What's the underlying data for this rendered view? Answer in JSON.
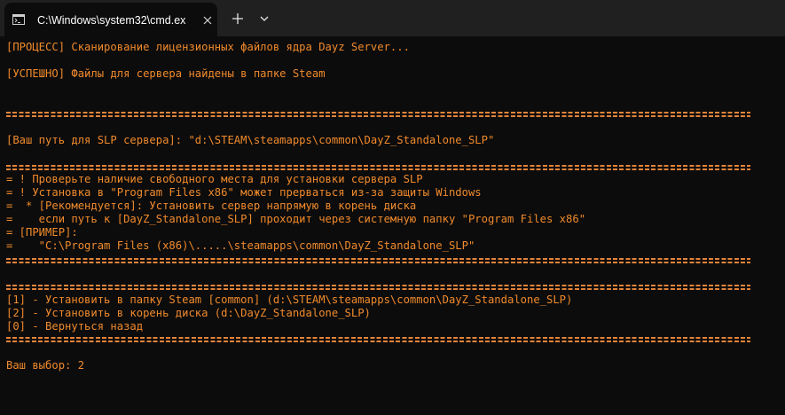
{
  "window": {
    "tab_title": "C:\\Windows\\system32\\cmd.ex",
    "icons": {
      "tab_icon": "cmd-icon",
      "close": "close-icon",
      "new_tab": "plus-icon",
      "dropdown": "chevron-down-icon"
    }
  },
  "colors": {
    "text": "#f08a2c",
    "background": "#0c0c0c",
    "titlebar": "#202020"
  },
  "console": {
    "line1": "[ПРОЦЕСС] Сканирование лицензионных файлов ядра Dayz Server...",
    "line2": "[УСПЕШНО] Файлы для сервера найдены в папке Steam",
    "separator": "=====================================================================================================================",
    "line3": "[Ваш путь для SLP сервера]: \"d:\\STEAM\\steamapps\\common\\DayZ_Standalone_SLP\"",
    "warn1": "= ! Проверьте наличие свободного места для установки сервера SLP",
    "warn2": "= ! Установка в \"Program Files x86\" может прерваться из-за защиты Windows",
    "warn3": "=  * [Рекомендуется]: Установить сервер напрямую в корень диска",
    "warn4": "=    если путь к [DayZ_Standalone_SLP] проходит через системную папку \"Program Files x86\"",
    "warn5": "= [ПРИМЕР]:",
    "warn6": "=    \"C:\\Program Files (x86)\\.....\\steamapps\\common\\DayZ_Standalone_SLP\"",
    "option1": "[1] - Установить в папку Steam [common] (d:\\STEAM\\steamapps\\common\\DayZ_Standalone_SLP)",
    "option2": "[2] - Установить в корень диска (d:\\DayZ_Standalone_SLP)",
    "option0": "[0] - Вернуться назад",
    "prompt": "Ваш выбор: 2"
  }
}
